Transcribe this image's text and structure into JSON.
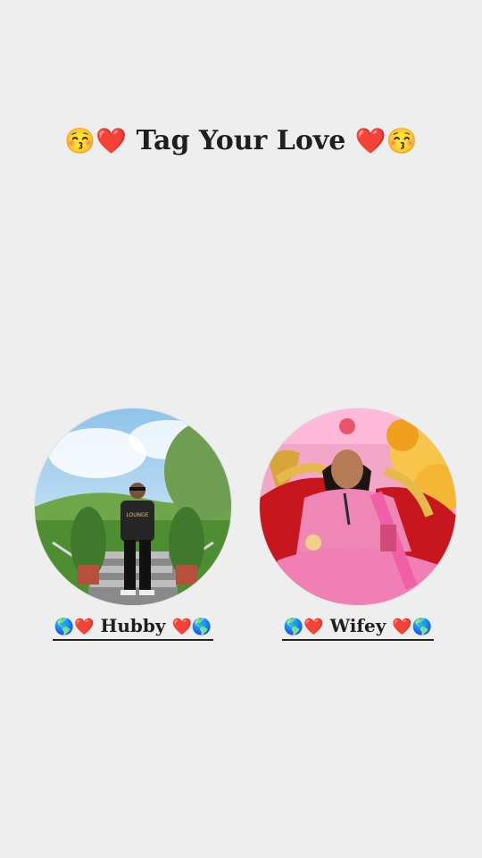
{
  "header": {
    "emoji_left": "😚❤️",
    "title": "Tag Your Love",
    "emoji_right": "❤️😚"
  },
  "profiles": [
    {
      "emoji_left": "🌎❤️",
      "label": "Hubby",
      "emoji_right": "❤️🌎",
      "shirt_text": "LOUNGE"
    },
    {
      "emoji_left": "🌎❤️",
      "label": "Wifey",
      "emoji_right": "❤️🌎"
    }
  ]
}
